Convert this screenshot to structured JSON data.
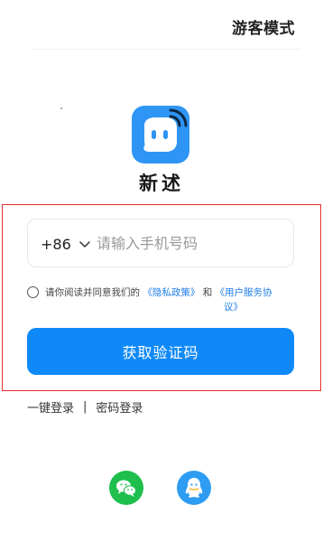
{
  "header": {
    "guest_mode": "游客模式"
  },
  "app": {
    "name": "新述",
    "logo_icon": "chat-bubble-wifi-logo",
    "brand_color": "#2f95f5"
  },
  "form": {
    "country_code": "+86",
    "country_code_icon": "chevron-down-icon",
    "phone_placeholder": "请输入手机号码",
    "phone_value": "",
    "agree_prefix": "请你阅读并同意我们的",
    "privacy_link": "《隐私政策》",
    "agree_and": "和",
    "terms_link_part1": "《用户服务协",
    "terms_link_part2": "议》",
    "agree_checked": false,
    "get_code_label": "获取验证码",
    "primary_color": "#0f89f7"
  },
  "alt_login": {
    "one_tap": "一键登录",
    "separator": "|",
    "password": "密码登录"
  },
  "social": [
    {
      "name": "wechat",
      "icon": "wechat-icon",
      "color": "#1fbf4e"
    },
    {
      "name": "qq",
      "icon": "qq-icon",
      "color": "#2d9cf2"
    }
  ],
  "highlight_color": "#e5302e"
}
